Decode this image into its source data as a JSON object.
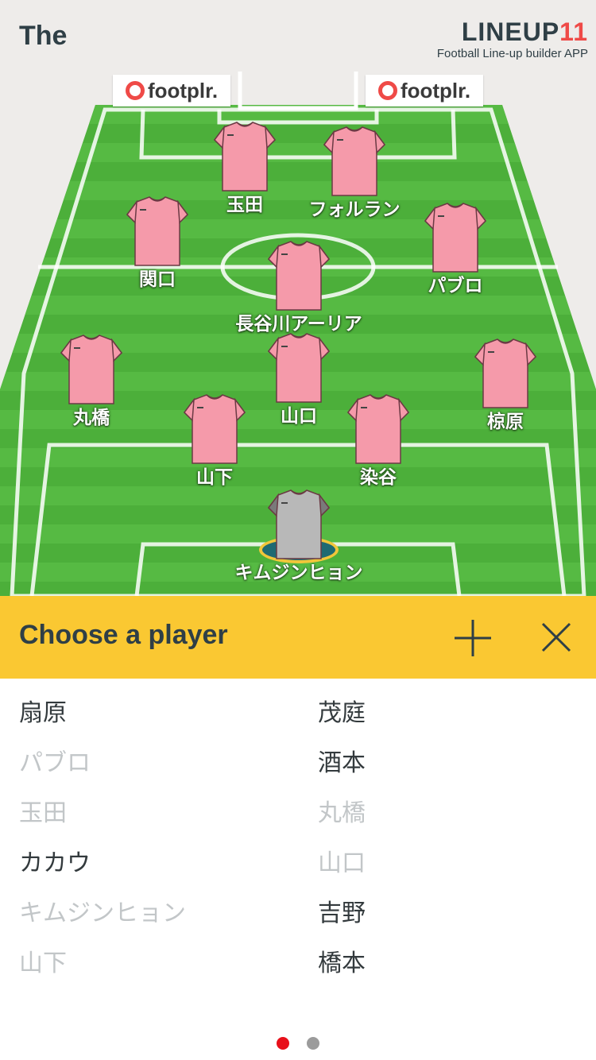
{
  "header": {
    "team_title": "The",
    "brand_name": "LINEUP",
    "brand_number": "11",
    "brand_subtitle": "Football Line-up builder APP"
  },
  "ads": [
    {
      "text": "footplr."
    },
    {
      "text": "footplr."
    }
  ],
  "formation": {
    "players": [
      {
        "name": "玉田",
        "kit": "pink"
      },
      {
        "name": "フォルラン",
        "kit": "pink"
      },
      {
        "name": "関口",
        "kit": "pink"
      },
      {
        "name": "パブロ",
        "kit": "pink"
      },
      {
        "name": "長谷川アーリア",
        "kit": "pink"
      },
      {
        "name": "丸橋",
        "kit": "pink"
      },
      {
        "name": "山口",
        "kit": "pink"
      },
      {
        "name": "椋原",
        "kit": "pink"
      },
      {
        "name": "山下",
        "kit": "pink"
      },
      {
        "name": "染谷",
        "kit": "pink"
      },
      {
        "name": "キムジンヒョン",
        "kit": "goalkeeper"
      }
    ]
  },
  "chooser": {
    "title": "Choose a player",
    "add_icon": "plus-icon",
    "close_icon": "close-icon"
  },
  "player_list": {
    "left": [
      {
        "name": "扇原",
        "disabled": false
      },
      {
        "name": "パブロ",
        "disabled": true
      },
      {
        "name": "玉田",
        "disabled": true
      },
      {
        "name": "カカウ",
        "disabled": false
      },
      {
        "name": "キムジンヒョン",
        "disabled": true
      },
      {
        "name": "山下",
        "disabled": true
      }
    ],
    "right": [
      {
        "name": "茂庭",
        "disabled": false
      },
      {
        "name": "酒本",
        "disabled": false
      },
      {
        "name": "丸橋",
        "disabled": true
      },
      {
        "name": "山口",
        "disabled": true
      },
      {
        "name": "吉野",
        "disabled": false
      },
      {
        "name": "橋本",
        "disabled": false
      }
    ]
  },
  "pager": {
    "pages": 2,
    "current": 1
  },
  "colors": {
    "accent": "#fac832",
    "shirt": "#f59aaa",
    "goalkeeper_shirt": "#b8b8b8",
    "text_dark": "#2f3f46",
    "text_disabled": "#c2c6c8",
    "brand_red": "#ef4a47",
    "pager_active": "#e8101a"
  }
}
